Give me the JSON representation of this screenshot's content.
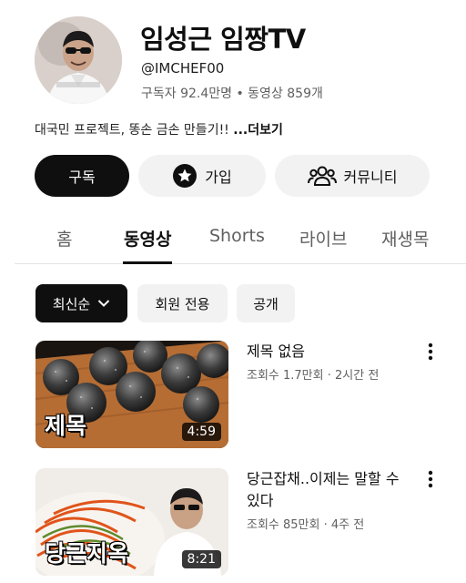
{
  "channel": {
    "name": "임성근 임짱TV",
    "handle": "@IMCHEF00",
    "stats": "구독자 92.4만명 • 동영상 859개",
    "description": "대국민 프로젝트,  똥손 금손 만들기!! ",
    "more_label": "...더보기"
  },
  "actions": {
    "subscribe_label": "구독",
    "join_label": "가입",
    "community_label": "커뮤니티"
  },
  "tabs": [
    {
      "label": "홈",
      "active": false
    },
    {
      "label": "동영상",
      "active": true
    },
    {
      "label": "Shorts",
      "active": false
    },
    {
      "label": "라이브",
      "active": false
    },
    {
      "label": "재생목",
      "active": false
    }
  ],
  "chips": [
    {
      "label": "최신순",
      "selected": true
    },
    {
      "label": "회원 전용",
      "selected": false
    },
    {
      "label": "공개",
      "selected": false
    }
  ],
  "videos": [
    {
      "title": "제목 없음",
      "meta": "조회수 1.7만회 · 2시간 전",
      "duration": "4:59",
      "thumb_text": "제목"
    },
    {
      "title": "당근잡채..이제는 말할 수 있다",
      "meta": "조회수 85만회 · 4주 전",
      "duration": "8:21",
      "thumb_text": "당근지옥"
    }
  ],
  "colors": {
    "primary": "#0f0f0f",
    "chip_bg": "#f2f2f2",
    "secondary_text": "#606060"
  }
}
